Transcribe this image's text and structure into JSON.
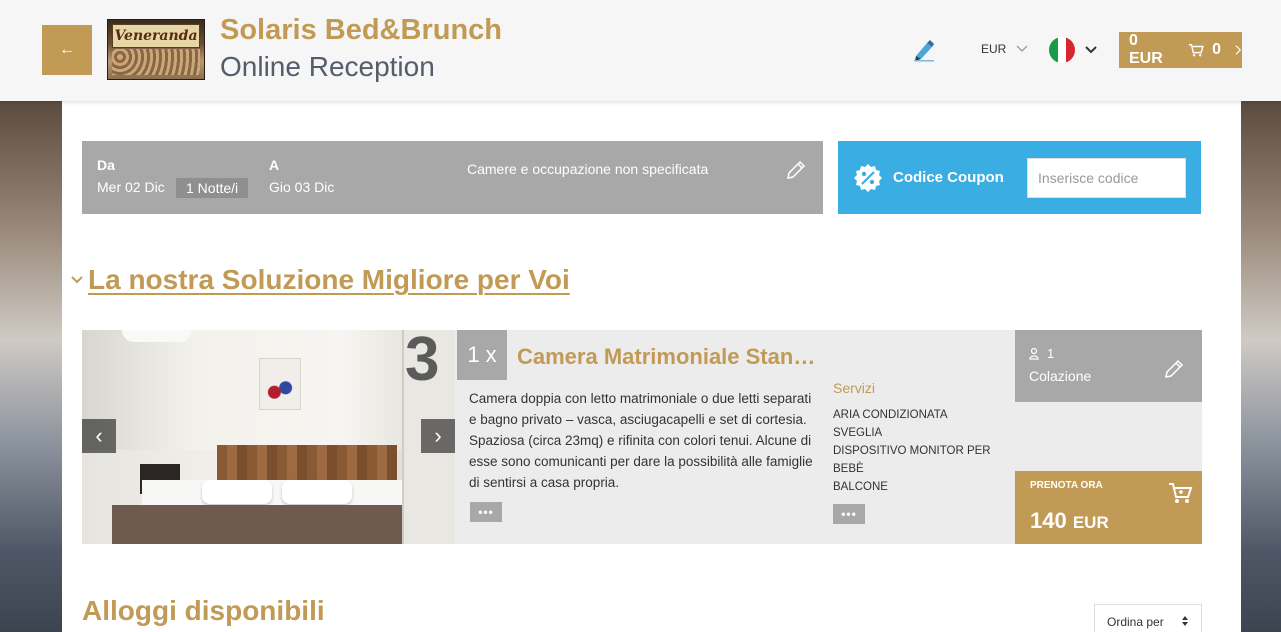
{
  "header": {
    "hotel_name": "Solaris Bed&Brunch",
    "subtitle": "Online Reception",
    "logo_text": "Veneranda",
    "currency": "EUR",
    "cart_total": "0 EUR",
    "cart_count": "0",
    "back_icon": "arrow-left-icon",
    "language_flag": "italy-flag"
  },
  "search": {
    "from_label": "Da",
    "from_date": "Mer 02 Dic",
    "nights": "1 Notte/i",
    "to_label": "A",
    "to_date": "Gio 03 Dic",
    "rooms_text": "Camere e occupazione non specificata"
  },
  "coupon": {
    "label": "Codice Coupon",
    "placeholder": "Inserisce codice"
  },
  "best": {
    "title": "La nostra Soluzione Migliore per Voi"
  },
  "offer": {
    "quantity": "1 x",
    "room_name": "Camera Matrimoniale Standard",
    "description": "Camera doppia con letto matrimoniale o due letti separati e bagno privato – vasca, asciugacapelli e set di cortesia. Spaziosa (circa 23mq) e rifinita con colori tenui. Alcune di esse sono comunicanti per dare la possibilità alle famiglie di sentirsi a casa propria.",
    "more": "•••",
    "services_title": "Servizi",
    "services": [
      "ARIA CONDIZIONATA",
      "SVEGLIA",
      "DISPOSITIVO MONITOR PER BEBÈ",
      "BALCONE"
    ],
    "guests": "1",
    "board": "Colazione",
    "book_label": "PRENOTA ORA",
    "price": "140",
    "price_currency": "EUR",
    "room_number": "3"
  },
  "available": {
    "title": "Alloggi disponibili",
    "sort_label": "Ordina per"
  },
  "colors": {
    "accent": "#c19a55",
    "coupon_bg": "#3aaee3",
    "gray_panel": "#a8a8a8"
  }
}
